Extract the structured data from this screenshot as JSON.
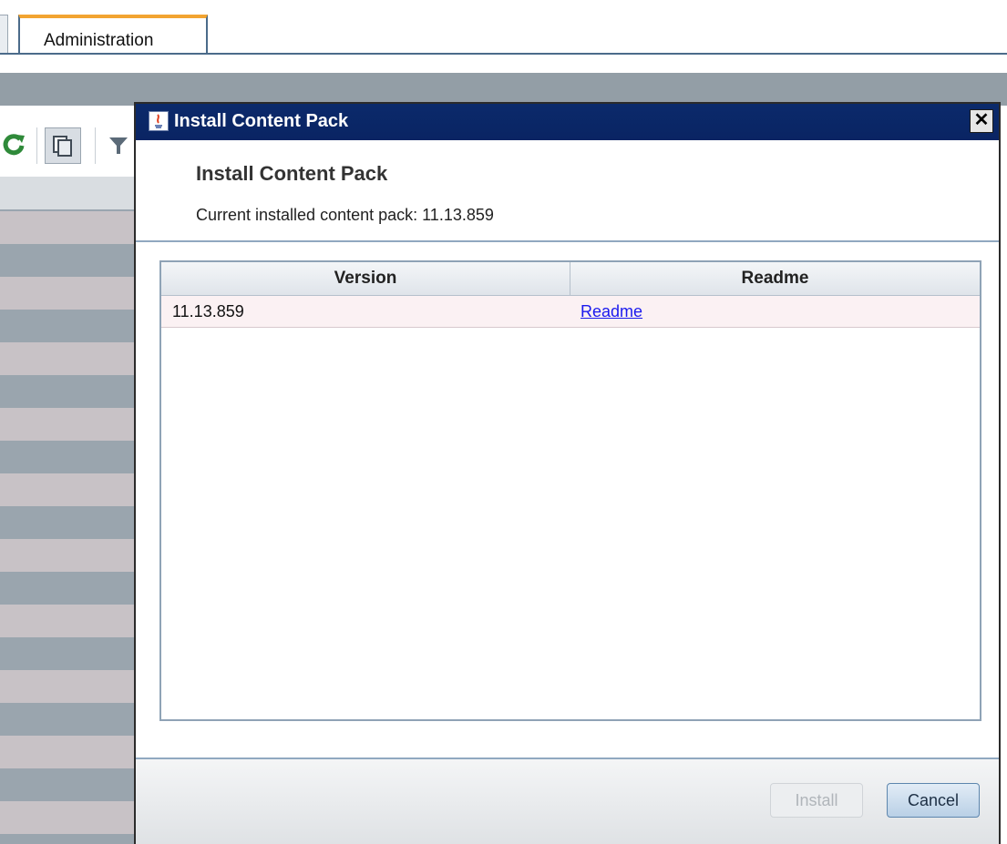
{
  "tabs": {
    "active_label": "Administration"
  },
  "toolbar": {
    "icons": [
      "refresh-icon",
      "duplicate-icon",
      "filter-icon"
    ]
  },
  "dialog": {
    "title": "Install Content Pack",
    "close_glyph": "✕",
    "heading": "Install Content Pack",
    "subtext": "Current installed content pack: 11.13.859",
    "table": {
      "columns": [
        "Version",
        "Readme"
      ],
      "rows": [
        {
          "version": "11.13.859",
          "readme": "Readme"
        }
      ]
    },
    "buttons": {
      "install": "Install",
      "cancel": "Cancel"
    }
  },
  "colors": {
    "titlebar": "#0a2463",
    "tab_accent": "#f2a431",
    "link": "#1a1aee"
  }
}
